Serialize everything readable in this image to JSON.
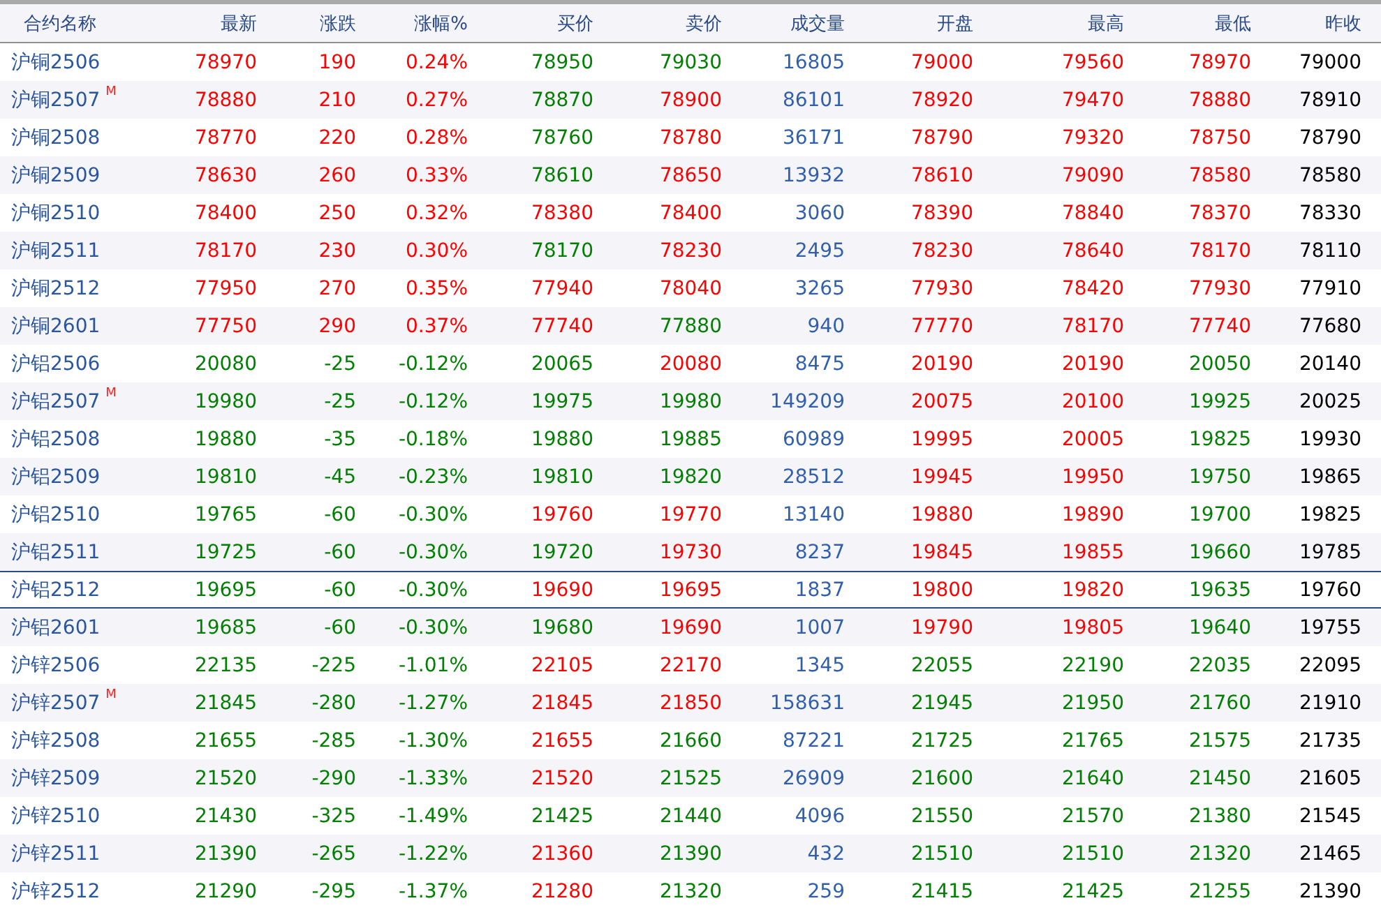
{
  "table": {
    "columns": [
      "合约名称",
      "最新",
      "涨跌",
      "涨幅%",
      "买价",
      "卖价",
      "成交量",
      "开盘",
      "最高",
      "最低",
      "昨收"
    ],
    "rows": [
      {
        "selected": false,
        "cells": [
          {
            "text": "沪铜2506"
          },
          {
            "text": "78970",
            "color": "#ff0000"
          },
          {
            "text": "190",
            "color": "#ff0000"
          },
          {
            "text": "0.24%",
            "color": "#ff0000"
          },
          {
            "text": "78950",
            "color": "#008000"
          },
          {
            "text": "79030",
            "color": "#008000"
          },
          {
            "text": "16805"
          },
          {
            "text": "79000",
            "color": "#ff0000"
          },
          {
            "text": "79560",
            "color": "#ff0000"
          },
          {
            "text": "78970",
            "color": "#ff0000"
          },
          {
            "text": "79000"
          }
        ]
      },
      {
        "selected": false,
        "cells": [
          {
            "text": "沪铜2507",
            "badge": "M"
          },
          {
            "text": "78880",
            "color": "#ff0000"
          },
          {
            "text": "210",
            "color": "#ff0000"
          },
          {
            "text": "0.27%",
            "color": "#ff0000"
          },
          {
            "text": "78870",
            "color": "#008000"
          },
          {
            "text": "78900",
            "color": "#ff0000"
          },
          {
            "text": "86101"
          },
          {
            "text": "78920",
            "color": "#ff0000"
          },
          {
            "text": "79470",
            "color": "#ff0000"
          },
          {
            "text": "78880",
            "color": "#ff0000"
          },
          {
            "text": "78910"
          }
        ]
      },
      {
        "selected": false,
        "cells": [
          {
            "text": "沪铜2508"
          },
          {
            "text": "78770",
            "color": "#ff0000"
          },
          {
            "text": "220",
            "color": "#ff0000"
          },
          {
            "text": "0.28%",
            "color": "#ff0000"
          },
          {
            "text": "78760",
            "color": "#008000"
          },
          {
            "text": "78780",
            "color": "#ff0000"
          },
          {
            "text": "36171"
          },
          {
            "text": "78790",
            "color": "#ff0000"
          },
          {
            "text": "79320",
            "color": "#ff0000"
          },
          {
            "text": "78750",
            "color": "#ff0000"
          },
          {
            "text": "78790"
          }
        ]
      },
      {
        "selected": false,
        "cells": [
          {
            "text": "沪铜2509"
          },
          {
            "text": "78630",
            "color": "#ff0000"
          },
          {
            "text": "260",
            "color": "#ff0000"
          },
          {
            "text": "0.33%",
            "color": "#ff0000"
          },
          {
            "text": "78610",
            "color": "#008000"
          },
          {
            "text": "78650",
            "color": "#ff0000"
          },
          {
            "text": "13932"
          },
          {
            "text": "78610",
            "color": "#ff0000"
          },
          {
            "text": "79090",
            "color": "#ff0000"
          },
          {
            "text": "78580",
            "color": "#ff0000"
          },
          {
            "text": "78580"
          }
        ]
      },
      {
        "selected": false,
        "cells": [
          {
            "text": "沪铜2510"
          },
          {
            "text": "78400",
            "color": "#ff0000"
          },
          {
            "text": "250",
            "color": "#ff0000"
          },
          {
            "text": "0.32%",
            "color": "#ff0000"
          },
          {
            "text": "78380",
            "color": "#ff0000"
          },
          {
            "text": "78400",
            "color": "#ff0000"
          },
          {
            "text": "3060"
          },
          {
            "text": "78390",
            "color": "#ff0000"
          },
          {
            "text": "78840",
            "color": "#ff0000"
          },
          {
            "text": "78370",
            "color": "#ff0000"
          },
          {
            "text": "78330"
          }
        ]
      },
      {
        "selected": false,
        "cells": [
          {
            "text": "沪铜2511"
          },
          {
            "text": "78170",
            "color": "#ff0000"
          },
          {
            "text": "230",
            "color": "#ff0000"
          },
          {
            "text": "0.30%",
            "color": "#ff0000"
          },
          {
            "text": "78170",
            "color": "#008000"
          },
          {
            "text": "78230",
            "color": "#ff0000"
          },
          {
            "text": "2495"
          },
          {
            "text": "78230",
            "color": "#ff0000"
          },
          {
            "text": "78640",
            "color": "#ff0000"
          },
          {
            "text": "78170",
            "color": "#ff0000"
          },
          {
            "text": "78110"
          }
        ]
      },
      {
        "selected": false,
        "cells": [
          {
            "text": "沪铜2512"
          },
          {
            "text": "77950",
            "color": "#ff0000"
          },
          {
            "text": "270",
            "color": "#ff0000"
          },
          {
            "text": "0.35%",
            "color": "#ff0000"
          },
          {
            "text": "77940",
            "color": "#ff0000"
          },
          {
            "text": "78040",
            "color": "#ff0000"
          },
          {
            "text": "3265"
          },
          {
            "text": "77930",
            "color": "#ff0000"
          },
          {
            "text": "78420",
            "color": "#ff0000"
          },
          {
            "text": "77930",
            "color": "#ff0000"
          },
          {
            "text": "77910"
          }
        ]
      },
      {
        "selected": false,
        "cells": [
          {
            "text": "沪铜2601"
          },
          {
            "text": "77750",
            "color": "#ff0000"
          },
          {
            "text": "290",
            "color": "#ff0000"
          },
          {
            "text": "0.37%",
            "color": "#ff0000"
          },
          {
            "text": "77740",
            "color": "#ff0000"
          },
          {
            "text": "77880",
            "color": "#008000"
          },
          {
            "text": "940"
          },
          {
            "text": "77770",
            "color": "#ff0000"
          },
          {
            "text": "78170",
            "color": "#ff0000"
          },
          {
            "text": "77740",
            "color": "#ff0000"
          },
          {
            "text": "77680"
          }
        ]
      },
      {
        "selected": false,
        "cells": [
          {
            "text": "沪铝2506"
          },
          {
            "text": "20080",
            "color": "#008000"
          },
          {
            "text": "-25",
            "color": "#008000"
          },
          {
            "text": "-0.12%",
            "color": "#008000"
          },
          {
            "text": "20065",
            "color": "#008000"
          },
          {
            "text": "20080",
            "color": "#ff0000"
          },
          {
            "text": "8475"
          },
          {
            "text": "20190",
            "color": "#ff0000"
          },
          {
            "text": "20190",
            "color": "#ff0000"
          },
          {
            "text": "20050",
            "color": "#008000"
          },
          {
            "text": "20140"
          }
        ]
      },
      {
        "selected": false,
        "cells": [
          {
            "text": "沪铝2507",
            "badge": "M"
          },
          {
            "text": "19980",
            "color": "#008000"
          },
          {
            "text": "-25",
            "color": "#008000"
          },
          {
            "text": "-0.12%",
            "color": "#008000"
          },
          {
            "text": "19975",
            "color": "#008000"
          },
          {
            "text": "19980",
            "color": "#008000"
          },
          {
            "text": "149209"
          },
          {
            "text": "20075",
            "color": "#ff0000"
          },
          {
            "text": "20100",
            "color": "#ff0000"
          },
          {
            "text": "19925",
            "color": "#008000"
          },
          {
            "text": "20025"
          }
        ]
      },
      {
        "selected": false,
        "cells": [
          {
            "text": "沪铝2508"
          },
          {
            "text": "19880",
            "color": "#008000"
          },
          {
            "text": "-35",
            "color": "#008000"
          },
          {
            "text": "-0.18%",
            "color": "#008000"
          },
          {
            "text": "19880",
            "color": "#008000"
          },
          {
            "text": "19885",
            "color": "#008000"
          },
          {
            "text": "60989"
          },
          {
            "text": "19995",
            "color": "#ff0000"
          },
          {
            "text": "20005",
            "color": "#ff0000"
          },
          {
            "text": "19825",
            "color": "#008000"
          },
          {
            "text": "19930"
          }
        ]
      },
      {
        "selected": false,
        "cells": [
          {
            "text": "沪铝2509"
          },
          {
            "text": "19810",
            "color": "#008000"
          },
          {
            "text": "-45",
            "color": "#008000"
          },
          {
            "text": "-0.23%",
            "color": "#008000"
          },
          {
            "text": "19810",
            "color": "#008000"
          },
          {
            "text": "19820",
            "color": "#008000"
          },
          {
            "text": "28512"
          },
          {
            "text": "19945",
            "color": "#ff0000"
          },
          {
            "text": "19950",
            "color": "#ff0000"
          },
          {
            "text": "19750",
            "color": "#008000"
          },
          {
            "text": "19865"
          }
        ]
      },
      {
        "selected": false,
        "cells": [
          {
            "text": "沪铝2510"
          },
          {
            "text": "19765",
            "color": "#008000"
          },
          {
            "text": "-60",
            "color": "#008000"
          },
          {
            "text": "-0.30%",
            "color": "#008000"
          },
          {
            "text": "19760",
            "color": "#ff0000"
          },
          {
            "text": "19770",
            "color": "#ff0000"
          },
          {
            "text": "13140"
          },
          {
            "text": "19880",
            "color": "#ff0000"
          },
          {
            "text": "19890",
            "color": "#ff0000"
          },
          {
            "text": "19700",
            "color": "#008000"
          },
          {
            "text": "19825"
          }
        ]
      },
      {
        "selected": false,
        "cells": [
          {
            "text": "沪铝2511"
          },
          {
            "text": "19725",
            "color": "#008000"
          },
          {
            "text": "-60",
            "color": "#008000"
          },
          {
            "text": "-0.30%",
            "color": "#008000"
          },
          {
            "text": "19720",
            "color": "#008000"
          },
          {
            "text": "19730",
            "color": "#ff0000"
          },
          {
            "text": "8237"
          },
          {
            "text": "19845",
            "color": "#ff0000"
          },
          {
            "text": "19855",
            "color": "#ff0000"
          },
          {
            "text": "19660",
            "color": "#008000"
          },
          {
            "text": "19785"
          }
        ]
      },
      {
        "selected": true,
        "cells": [
          {
            "text": "沪铝2512"
          },
          {
            "text": "19695",
            "color": "#008000"
          },
          {
            "text": "-60",
            "color": "#008000"
          },
          {
            "text": "-0.30%",
            "color": "#008000"
          },
          {
            "text": "19690",
            "color": "#ff0000"
          },
          {
            "text": "19695",
            "color": "#ff0000"
          },
          {
            "text": "1837"
          },
          {
            "text": "19800",
            "color": "#ff0000"
          },
          {
            "text": "19820",
            "color": "#ff0000"
          },
          {
            "text": "19635",
            "color": "#008000"
          },
          {
            "text": "19760"
          }
        ]
      },
      {
        "selected": false,
        "cells": [
          {
            "text": "沪铝2601"
          },
          {
            "text": "19685",
            "color": "#008000"
          },
          {
            "text": "-60",
            "color": "#008000"
          },
          {
            "text": "-0.30%",
            "color": "#008000"
          },
          {
            "text": "19680",
            "color": "#008000"
          },
          {
            "text": "19690",
            "color": "#ff0000"
          },
          {
            "text": "1007"
          },
          {
            "text": "19790",
            "color": "#ff0000"
          },
          {
            "text": "19805",
            "color": "#ff0000"
          },
          {
            "text": "19640",
            "color": "#008000"
          },
          {
            "text": "19755"
          }
        ]
      },
      {
        "selected": false,
        "cells": [
          {
            "text": "沪锌2506"
          },
          {
            "text": "22135",
            "color": "#008000"
          },
          {
            "text": "-225",
            "color": "#008000"
          },
          {
            "text": "-1.01%",
            "color": "#008000"
          },
          {
            "text": "22105",
            "color": "#ff0000"
          },
          {
            "text": "22170",
            "color": "#ff0000"
          },
          {
            "text": "1345"
          },
          {
            "text": "22055",
            "color": "#008000"
          },
          {
            "text": "22190",
            "color": "#008000"
          },
          {
            "text": "22035",
            "color": "#008000"
          },
          {
            "text": "22095"
          }
        ]
      },
      {
        "selected": false,
        "cells": [
          {
            "text": "沪锌2507",
            "badge": "M"
          },
          {
            "text": "21845",
            "color": "#008000"
          },
          {
            "text": "-280",
            "color": "#008000"
          },
          {
            "text": "-1.27%",
            "color": "#008000"
          },
          {
            "text": "21845",
            "color": "#ff0000"
          },
          {
            "text": "21850",
            "color": "#ff0000"
          },
          {
            "text": "158631"
          },
          {
            "text": "21945",
            "color": "#008000"
          },
          {
            "text": "21950",
            "color": "#008000"
          },
          {
            "text": "21760",
            "color": "#008000"
          },
          {
            "text": "21910"
          }
        ]
      },
      {
        "selected": false,
        "cells": [
          {
            "text": "沪锌2508"
          },
          {
            "text": "21655",
            "color": "#008000"
          },
          {
            "text": "-285",
            "color": "#008000"
          },
          {
            "text": "-1.30%",
            "color": "#008000"
          },
          {
            "text": "21655",
            "color": "#ff0000"
          },
          {
            "text": "21660",
            "color": "#008000"
          },
          {
            "text": "87221"
          },
          {
            "text": "21725",
            "color": "#008000"
          },
          {
            "text": "21765",
            "color": "#008000"
          },
          {
            "text": "21575",
            "color": "#008000"
          },
          {
            "text": "21735"
          }
        ]
      },
      {
        "selected": false,
        "cells": [
          {
            "text": "沪锌2509"
          },
          {
            "text": "21520",
            "color": "#008000"
          },
          {
            "text": "-290",
            "color": "#008000"
          },
          {
            "text": "-1.33%",
            "color": "#008000"
          },
          {
            "text": "21520",
            "color": "#ff0000"
          },
          {
            "text": "21525",
            "color": "#008000"
          },
          {
            "text": "26909"
          },
          {
            "text": "21600",
            "color": "#008000"
          },
          {
            "text": "21640",
            "color": "#008000"
          },
          {
            "text": "21450",
            "color": "#008000"
          },
          {
            "text": "21605"
          }
        ]
      },
      {
        "selected": false,
        "cells": [
          {
            "text": "沪锌2510"
          },
          {
            "text": "21430",
            "color": "#008000"
          },
          {
            "text": "-325",
            "color": "#008000"
          },
          {
            "text": "-1.49%",
            "color": "#008000"
          },
          {
            "text": "21425",
            "color": "#008000"
          },
          {
            "text": "21440",
            "color": "#008000"
          },
          {
            "text": "4096"
          },
          {
            "text": "21550",
            "color": "#008000"
          },
          {
            "text": "21570",
            "color": "#008000"
          },
          {
            "text": "21380",
            "color": "#008000"
          },
          {
            "text": "21545"
          }
        ]
      },
      {
        "selected": false,
        "cells": [
          {
            "text": "沪锌2511"
          },
          {
            "text": "21390",
            "color": "#008000"
          },
          {
            "text": "-265",
            "color": "#008000"
          },
          {
            "text": "-1.22%",
            "color": "#008000"
          },
          {
            "text": "21360",
            "color": "#ff0000"
          },
          {
            "text": "21390",
            "color": "#008000"
          },
          {
            "text": "432"
          },
          {
            "text": "21510",
            "color": "#008000"
          },
          {
            "text": "21510",
            "color": "#008000"
          },
          {
            "text": "21320",
            "color": "#008000"
          },
          {
            "text": "21465"
          }
        ]
      },
      {
        "selected": false,
        "cells": [
          {
            "text": "沪锌2512"
          },
          {
            "text": "21290",
            "color": "#008000"
          },
          {
            "text": "-295",
            "color": "#008000"
          },
          {
            "text": "-1.37%",
            "color": "#008000"
          },
          {
            "text": "21280",
            "color": "#ff0000"
          },
          {
            "text": "21320",
            "color": "#008000"
          },
          {
            "text": "259"
          },
          {
            "text": "21415",
            "color": "#008000"
          },
          {
            "text": "21425",
            "color": "#008000"
          },
          {
            "text": "21255",
            "color": "#008000"
          },
          {
            "text": "21390"
          }
        ]
      }
    ]
  }
}
